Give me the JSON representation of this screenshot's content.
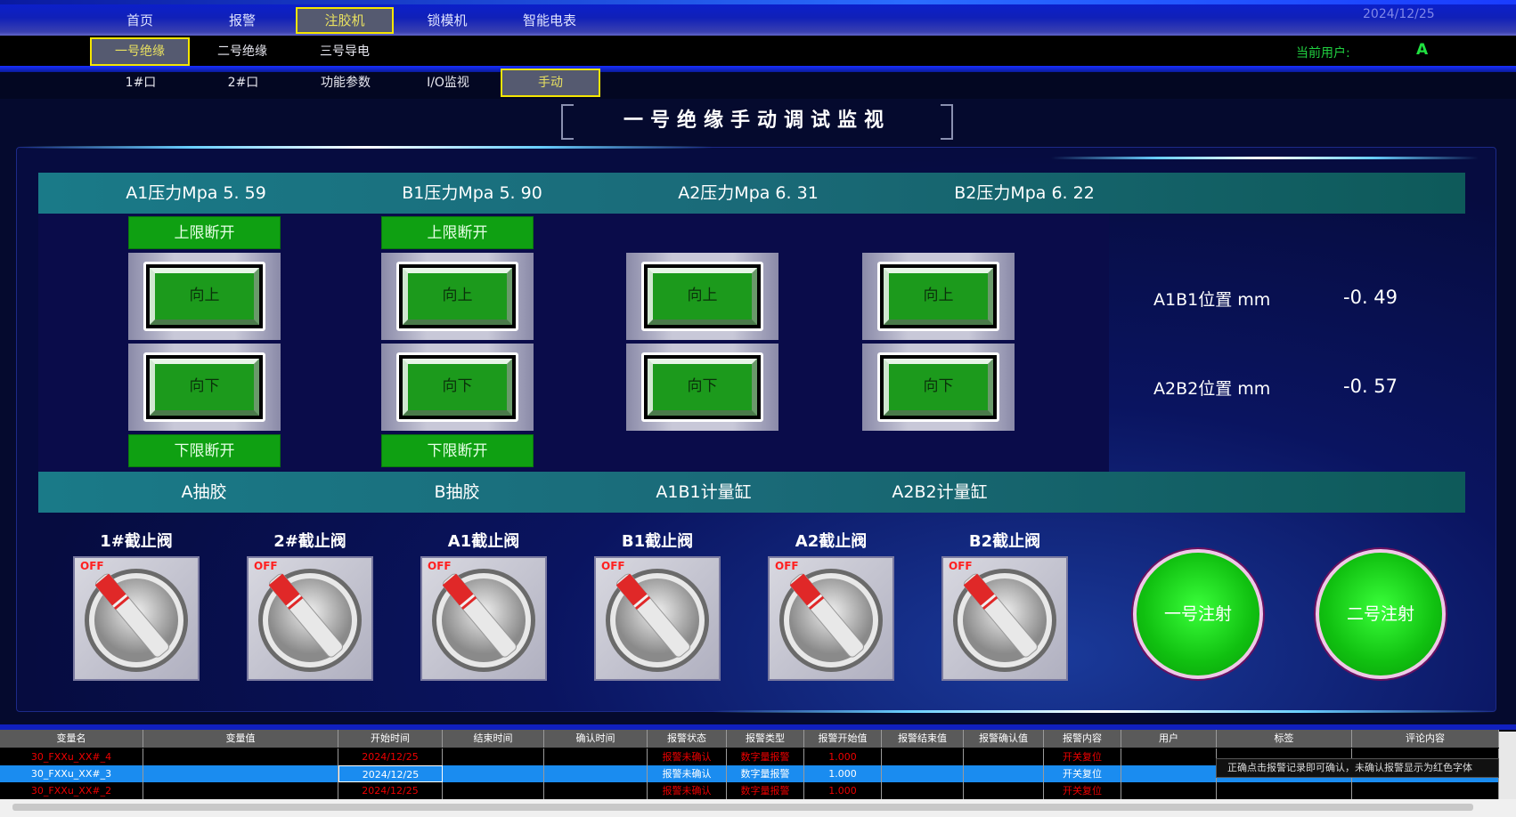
{
  "nav": {
    "items": [
      "首页",
      "报警",
      "注胶机",
      "锁模机",
      "智能电表"
    ],
    "selected": 2,
    "date": "2024/12/25"
  },
  "subnav": {
    "items": [
      "一号绝缘",
      "二号绝缘",
      "三号导电"
    ],
    "selected": 0,
    "user_label": "当前用户:",
    "user_value": "A"
  },
  "tabs": {
    "items": [
      "1#口",
      "2#口",
      "功能参数",
      "I/O监视",
      "手动"
    ],
    "selected": 4
  },
  "title": "一号绝缘手动调试监视",
  "pressures": [
    "A1压力Mpa 5. 59",
    "B1压力Mpa 5. 90",
    "A2压力Mpa 6. 31",
    "B2压力Mpa 6. 22"
  ],
  "columns": [
    {
      "upper": "上限断开",
      "up": "向上",
      "down": "向下",
      "lower": "下限断开"
    },
    {
      "upper": "上限断开",
      "up": "向上",
      "down": "向下",
      "lower": "下限断开"
    },
    {
      "upper": "",
      "up": "向上",
      "down": "向下",
      "lower": ""
    },
    {
      "upper": "",
      "up": "向上",
      "down": "向下",
      "lower": ""
    }
  ],
  "positions": [
    {
      "label": "A1B1位置 mm",
      "value": "-0. 49"
    },
    {
      "label": "A2B2位置 mm",
      "value": "-0. 57"
    }
  ],
  "groups": [
    "A抽胶",
    "B抽胶",
    "A1B1计量缸",
    "A2B2计量缸"
  ],
  "valves": [
    {
      "label": "1#截止阀",
      "state": "OFF"
    },
    {
      "label": "2#截止阀",
      "state": "OFF"
    },
    {
      "label": "A1截止阀",
      "state": "OFF"
    },
    {
      "label": "B1截止阀",
      "state": "OFF"
    },
    {
      "label": "A2截止阀",
      "state": "OFF"
    },
    {
      "label": "B2截止阀",
      "state": "OFF"
    }
  ],
  "inject_buttons": [
    "一号注射",
    "二号注射"
  ],
  "alarm_table": {
    "headers": [
      "变量名",
      "变量值",
      "开始时间",
      "结束时间",
      "确认时间",
      "报警状态",
      "报警类型",
      "报警开始值",
      "报警结束值",
      "报警确认值",
      "报警内容",
      "用户",
      "标签",
      "评论内容"
    ],
    "rows": [
      [
        "30_FXXu_XX#_4",
        "",
        "2024/12/25",
        "",
        "",
        "报警未确认",
        "数字量报警",
        "1.000",
        "",
        "",
        "开关复位",
        "",
        "",
        ""
      ],
      [
        "30_FXXu_XX#_3",
        "",
        "2024/12/25",
        "",
        "",
        "报警未确认",
        "数字量报警",
        "1.000",
        "",
        "",
        "开关复位",
        "",
        "",
        ""
      ],
      [
        "30_FXXu_XX#_2",
        "",
        "2024/12/25",
        "",
        "",
        "报警未确认",
        "数字量报警",
        "1.000",
        "",
        "",
        "开关复位",
        "",
        "",
        ""
      ]
    ],
    "selected_row": 1,
    "tooltip": "正确点击报警记录即可确认，未确认报警显示为红色字体"
  },
  "colors": {
    "accent": "#f5e600",
    "green_button": "#10c010",
    "alarm_text": "#ee0000",
    "selected_row": "#1a8cf0"
  }
}
